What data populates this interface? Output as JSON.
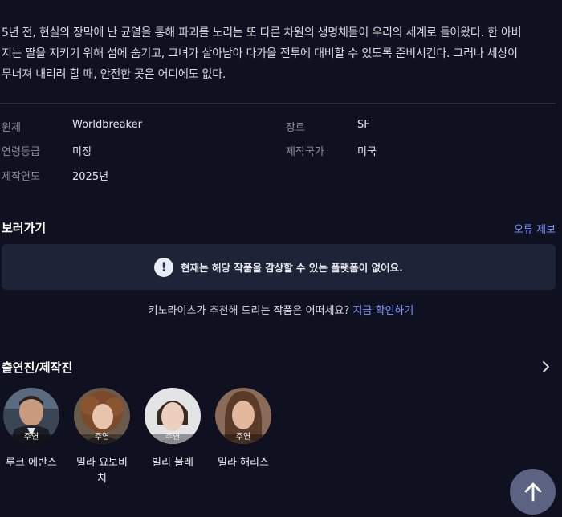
{
  "synopsis": {
    "line1": "5년 전, 현실의 장막에 난 균열을 통해 파괴를 노리는 또 다른 차원의 생명체들이 우리의 세계로 들어왔다. 한 아버",
    "line2": "지는 딸을 지키기 위해 섬에 숨기고, 그녀가 살아남아 다가올 전투에 대비할 수 있도록 준비시킨다. 그러나 세상이",
    "line3": "무너져 내리려 할 때, 안전한 곳은 어디에도 없다."
  },
  "meta": {
    "original_title_label": "원제",
    "original_title_value": "Worldbreaker",
    "genre_label": "장르",
    "genre_value": "SF",
    "rating_label": "연령등급",
    "rating_value": "미정",
    "country_label": "제작국가",
    "country_value": "미국",
    "year_label": "제작연도",
    "year_value": "2025년"
  },
  "watch": {
    "title": "보러가기",
    "report_link": "오류 제보",
    "notice_icon": "!",
    "notice_text": "현재는 해당 작품을 감상할 수 있는 플랫폼이 없어요.",
    "recommend_text": "키노라이츠가 추천해 드리는 작품은 어떠세요?",
    "recommend_link": "지금 확인하기"
  },
  "cast": {
    "title": "출연진/제작진",
    "items": [
      {
        "role": "주연",
        "name": "루크 에반스"
      },
      {
        "role": "주연",
        "name": "밀라 요보비\n치"
      },
      {
        "role": "주연",
        "name": "빌리 불레"
      },
      {
        "role": "주연",
        "name": "밀라 해리스"
      }
    ]
  },
  "icons": {
    "chevron": "chevron-right-icon",
    "scroll_top": "arrow-up-icon",
    "notice": "exclamation-icon"
  },
  "colors": {
    "background": "#0f1120",
    "accent_link": "#7b93ff",
    "notice_bg": "#1e2437",
    "scroll_button": "#5b6282"
  }
}
